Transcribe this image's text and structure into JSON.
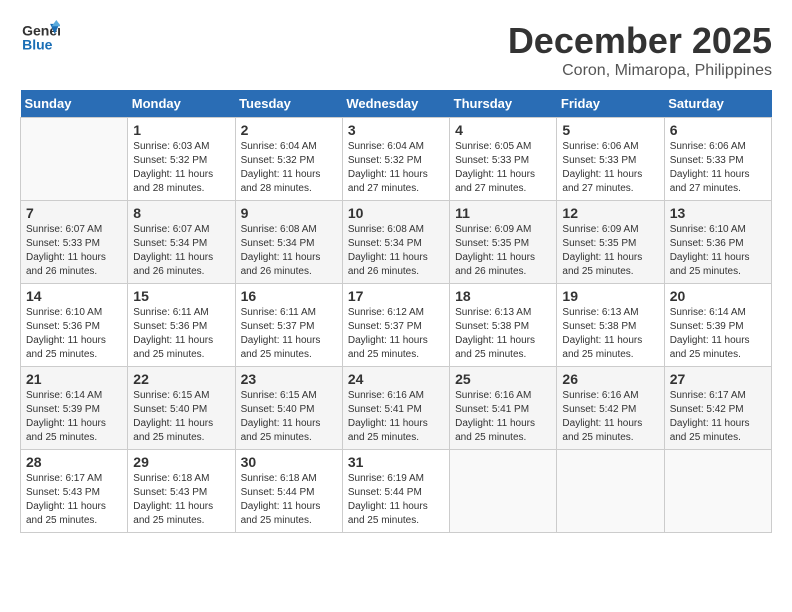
{
  "header": {
    "logo_line1": "General",
    "logo_line2": "Blue",
    "month_title": "December 2025",
    "location": "Coron, Mimaropa, Philippines"
  },
  "days_of_week": [
    "Sunday",
    "Monday",
    "Tuesday",
    "Wednesday",
    "Thursday",
    "Friday",
    "Saturday"
  ],
  "weeks": [
    [
      {
        "day": "",
        "sunrise": "",
        "sunset": "",
        "daylight": ""
      },
      {
        "day": "1",
        "sunrise": "Sunrise: 6:03 AM",
        "sunset": "Sunset: 5:32 PM",
        "daylight": "Daylight: 11 hours and 28 minutes."
      },
      {
        "day": "2",
        "sunrise": "Sunrise: 6:04 AM",
        "sunset": "Sunset: 5:32 PM",
        "daylight": "Daylight: 11 hours and 28 minutes."
      },
      {
        "day": "3",
        "sunrise": "Sunrise: 6:04 AM",
        "sunset": "Sunset: 5:32 PM",
        "daylight": "Daylight: 11 hours and 27 minutes."
      },
      {
        "day": "4",
        "sunrise": "Sunrise: 6:05 AM",
        "sunset": "Sunset: 5:33 PM",
        "daylight": "Daylight: 11 hours and 27 minutes."
      },
      {
        "day": "5",
        "sunrise": "Sunrise: 6:06 AM",
        "sunset": "Sunset: 5:33 PM",
        "daylight": "Daylight: 11 hours and 27 minutes."
      },
      {
        "day": "6",
        "sunrise": "Sunrise: 6:06 AM",
        "sunset": "Sunset: 5:33 PM",
        "daylight": "Daylight: 11 hours and 27 minutes."
      }
    ],
    [
      {
        "day": "7",
        "sunrise": "Sunrise: 6:07 AM",
        "sunset": "Sunset: 5:33 PM",
        "daylight": "Daylight: 11 hours and 26 minutes."
      },
      {
        "day": "8",
        "sunrise": "Sunrise: 6:07 AM",
        "sunset": "Sunset: 5:34 PM",
        "daylight": "Daylight: 11 hours and 26 minutes."
      },
      {
        "day": "9",
        "sunrise": "Sunrise: 6:08 AM",
        "sunset": "Sunset: 5:34 PM",
        "daylight": "Daylight: 11 hours and 26 minutes."
      },
      {
        "day": "10",
        "sunrise": "Sunrise: 6:08 AM",
        "sunset": "Sunset: 5:34 PM",
        "daylight": "Daylight: 11 hours and 26 minutes."
      },
      {
        "day": "11",
        "sunrise": "Sunrise: 6:09 AM",
        "sunset": "Sunset: 5:35 PM",
        "daylight": "Daylight: 11 hours and 26 minutes."
      },
      {
        "day": "12",
        "sunrise": "Sunrise: 6:09 AM",
        "sunset": "Sunset: 5:35 PM",
        "daylight": "Daylight: 11 hours and 25 minutes."
      },
      {
        "day": "13",
        "sunrise": "Sunrise: 6:10 AM",
        "sunset": "Sunset: 5:36 PM",
        "daylight": "Daylight: 11 hours and 25 minutes."
      }
    ],
    [
      {
        "day": "14",
        "sunrise": "Sunrise: 6:10 AM",
        "sunset": "Sunset: 5:36 PM",
        "daylight": "Daylight: 11 hours and 25 minutes."
      },
      {
        "day": "15",
        "sunrise": "Sunrise: 6:11 AM",
        "sunset": "Sunset: 5:36 PM",
        "daylight": "Daylight: 11 hours and 25 minutes."
      },
      {
        "day": "16",
        "sunrise": "Sunrise: 6:11 AM",
        "sunset": "Sunset: 5:37 PM",
        "daylight": "Daylight: 11 hours and 25 minutes."
      },
      {
        "day": "17",
        "sunrise": "Sunrise: 6:12 AM",
        "sunset": "Sunset: 5:37 PM",
        "daylight": "Daylight: 11 hours and 25 minutes."
      },
      {
        "day": "18",
        "sunrise": "Sunrise: 6:13 AM",
        "sunset": "Sunset: 5:38 PM",
        "daylight": "Daylight: 11 hours and 25 minutes."
      },
      {
        "day": "19",
        "sunrise": "Sunrise: 6:13 AM",
        "sunset": "Sunset: 5:38 PM",
        "daylight": "Daylight: 11 hours and 25 minutes."
      },
      {
        "day": "20",
        "sunrise": "Sunrise: 6:14 AM",
        "sunset": "Sunset: 5:39 PM",
        "daylight": "Daylight: 11 hours and 25 minutes."
      }
    ],
    [
      {
        "day": "21",
        "sunrise": "Sunrise: 6:14 AM",
        "sunset": "Sunset: 5:39 PM",
        "daylight": "Daylight: 11 hours and 25 minutes."
      },
      {
        "day": "22",
        "sunrise": "Sunrise: 6:15 AM",
        "sunset": "Sunset: 5:40 PM",
        "daylight": "Daylight: 11 hours and 25 minutes."
      },
      {
        "day": "23",
        "sunrise": "Sunrise: 6:15 AM",
        "sunset": "Sunset: 5:40 PM",
        "daylight": "Daylight: 11 hours and 25 minutes."
      },
      {
        "day": "24",
        "sunrise": "Sunrise: 6:16 AM",
        "sunset": "Sunset: 5:41 PM",
        "daylight": "Daylight: 11 hours and 25 minutes."
      },
      {
        "day": "25",
        "sunrise": "Sunrise: 6:16 AM",
        "sunset": "Sunset: 5:41 PM",
        "daylight": "Daylight: 11 hours and 25 minutes."
      },
      {
        "day": "26",
        "sunrise": "Sunrise: 6:16 AM",
        "sunset": "Sunset: 5:42 PM",
        "daylight": "Daylight: 11 hours and 25 minutes."
      },
      {
        "day": "27",
        "sunrise": "Sunrise: 6:17 AM",
        "sunset": "Sunset: 5:42 PM",
        "daylight": "Daylight: 11 hours and 25 minutes."
      }
    ],
    [
      {
        "day": "28",
        "sunrise": "Sunrise: 6:17 AM",
        "sunset": "Sunset: 5:43 PM",
        "daylight": "Daylight: 11 hours and 25 minutes."
      },
      {
        "day": "29",
        "sunrise": "Sunrise: 6:18 AM",
        "sunset": "Sunset: 5:43 PM",
        "daylight": "Daylight: 11 hours and 25 minutes."
      },
      {
        "day": "30",
        "sunrise": "Sunrise: 6:18 AM",
        "sunset": "Sunset: 5:44 PM",
        "daylight": "Daylight: 11 hours and 25 minutes."
      },
      {
        "day": "31",
        "sunrise": "Sunrise: 6:19 AM",
        "sunset": "Sunset: 5:44 PM",
        "daylight": "Daylight: 11 hours and 25 minutes."
      },
      {
        "day": "",
        "sunrise": "",
        "sunset": "",
        "daylight": ""
      },
      {
        "day": "",
        "sunrise": "",
        "sunset": "",
        "daylight": ""
      },
      {
        "day": "",
        "sunrise": "",
        "sunset": "",
        "daylight": ""
      }
    ]
  ]
}
